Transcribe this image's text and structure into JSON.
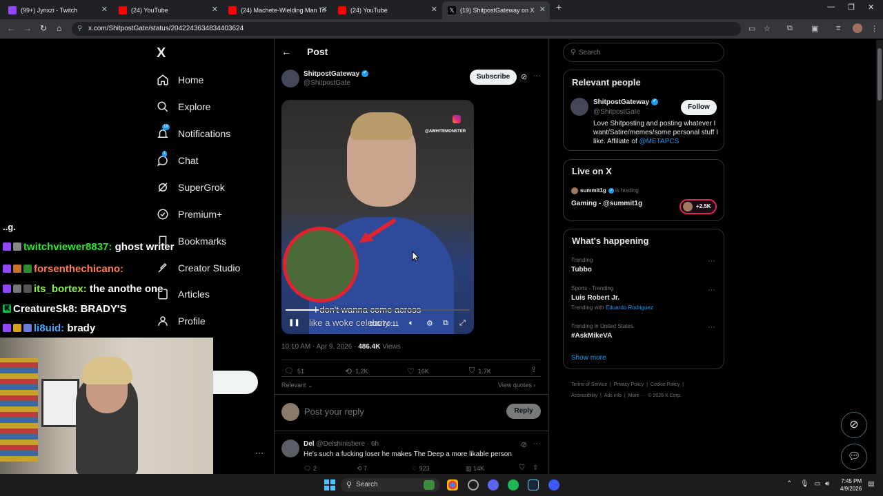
{
  "browser": {
    "tabs": [
      {
        "title": "(99+) Jynxzi - Twitch",
        "favicon_color": "#9146ff"
      },
      {
        "title": "(24) YouTube",
        "favicon_color": "#ff0000"
      },
      {
        "title": "(24) Machete-Wielding Man Tri",
        "favicon_color": "#ff0000"
      },
      {
        "title": "(24) YouTube",
        "favicon_color": "#ff0000"
      },
      {
        "title": "(19) ShitpostGateway on X",
        "favicon_color": "#ffffff"
      }
    ],
    "url": "x.com/ShitpostGate/status/2042243634834403624"
  },
  "x_nav": {
    "logo": "X",
    "items": [
      {
        "label": "Home",
        "icon": "home-icon"
      },
      {
        "label": "Explore",
        "icon": "search-icon"
      },
      {
        "label": "Notifications",
        "icon": "bell-icon",
        "badge": "18"
      },
      {
        "label": "Chat",
        "icon": "chat-icon",
        "badge": "1"
      },
      {
        "label": "SuperGrok",
        "icon": "grok-icon"
      },
      {
        "label": "Premium+",
        "icon": "premium-icon"
      },
      {
        "label": "Bookmarks",
        "icon": "bookmark-icon"
      },
      {
        "label": "Creator Studio",
        "icon": "creator-icon"
      },
      {
        "label": "Articles",
        "icon": "article-icon"
      },
      {
        "label": "Profile",
        "icon": "person-icon"
      }
    ],
    "more": "···"
  },
  "twitch_chat": [
    {
      "user": "twitchviewer8837:",
      "message": "ghost writer",
      "color": "#2ee62e"
    },
    {
      "user": "forsenthechicano:",
      "message": "",
      "color": "#ff7f50"
    },
    {
      "user": "its_bortex:",
      "message": "the anothe one",
      "color": "#8aef5a"
    },
    {
      "user": "CreatureSk8:",
      "message": "BRADY'S",
      "color": "#ffffff"
    },
    {
      "user": "li8uid:",
      "message": "brady",
      "color": "#4aa8ff"
    }
  ],
  "twitch_partial": "..g.",
  "post": {
    "header": "Post",
    "author_name": "ShitpostGateway",
    "author_handle": "@ShitpostGate",
    "subscribe_label": "Subscribe",
    "video": {
      "watermark": "@AWHITEMONSTER",
      "caption": "I don't wanna come across",
      "caption2": "like a woke celebrity",
      "time": "0:02 / 0:11"
    },
    "timestamp": "10:10 AM · Apr 9, 2026 · ",
    "views_count": "486.4K",
    "views_label": "Views",
    "replies": "51",
    "reposts": "1.2K",
    "likes": "16K",
    "bookmarks": "1.7K",
    "sort_label": "Relevant",
    "view_quotes": "View quotes",
    "reply_placeholder": "Post your reply",
    "reply_button": "Reply"
  },
  "reply": {
    "name": "Del",
    "handle": "@Delshinishere · 6h",
    "text": "He's such a fucking loser he makes The Deep a more likable person",
    "replies": "2",
    "reposts": "7",
    "likes": "923",
    "views": "14K"
  },
  "sidebar": {
    "search_placeholder": "Search",
    "relevant": {
      "title": "Relevant people",
      "name": "ShitpostGateway",
      "handle": "@ShitpostGate",
      "follow": "Follow",
      "bio": "Love Shitposting and posting whatever I want/Satire/memes/some personal stuff I like. Affiliate of",
      "bio_link": "@METAPCS"
    },
    "live": {
      "title": "Live on X",
      "host": "summit1g",
      "hosting": "is hosting",
      "space": "Gaming - @summit1g",
      "listeners": "+2.5K"
    },
    "happening": {
      "title": "What's happening",
      "trends": [
        {
          "meta": "Trending",
          "name": "Tubbo",
          "with": ""
        },
        {
          "meta": "Sports · Trending",
          "name": "Luis Robert Jr.",
          "with": "Eduardo Rodriguez"
        },
        {
          "meta": "Trending in United States",
          "name": "#AskMikeVA",
          "with": ""
        }
      ],
      "trending_with": "Trending with",
      "show_more": "Show more"
    },
    "footer": [
      "Terms of Service",
      "Privacy Policy",
      "Cookie Policy",
      "Accessibility",
      "Ads info",
      "More ···",
      "© 2026 X Corp."
    ]
  },
  "taskbar": {
    "search": "Search",
    "time": "7:45 PM",
    "date": "4/9/2026"
  },
  "colors": {
    "accent": "#1d9bf0",
    "bg": "#000000",
    "border": "#2f3336"
  }
}
